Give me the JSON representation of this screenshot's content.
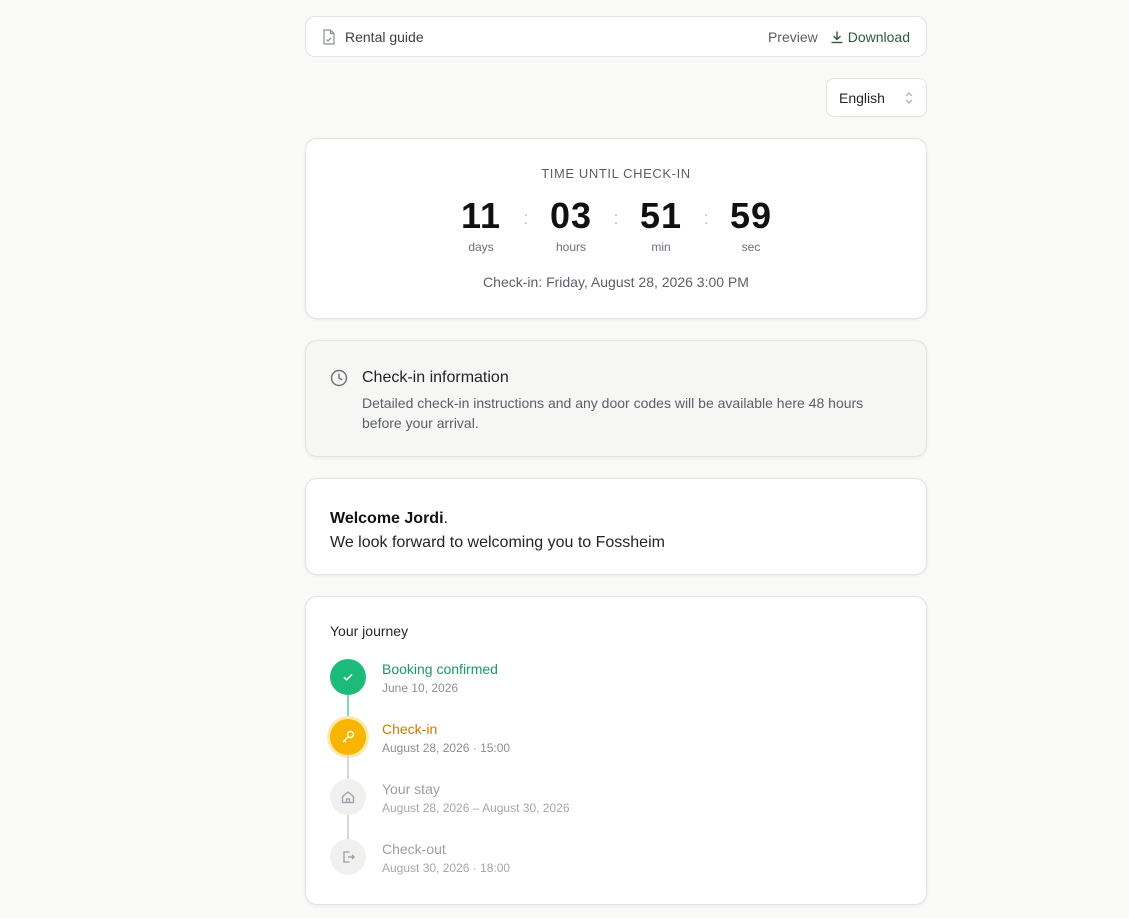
{
  "topbar": {
    "title": "Rental guide",
    "preview_label": "Preview",
    "download_label": "Download",
    "icons": {
      "doc": "document-icon",
      "download": "download-icon"
    }
  },
  "language": {
    "selected": "English"
  },
  "countdown": {
    "label": "TIME UNTIL CHECK-IN",
    "days": "11",
    "days_unit": "days",
    "hours": "03",
    "hours_unit": "hours",
    "minutes": "51",
    "minutes_unit": "min",
    "seconds": "59",
    "seconds_unit": "sec",
    "separator": ":",
    "checkin_text": "Check-in: Friday, August 28, 2026 3:00 PM"
  },
  "info": {
    "heading": "Check-in information",
    "description": "Detailed check-in instructions and any door codes will be available here 48 hours before your arrival."
  },
  "welcome": {
    "greeting": "Welcome Jordi",
    "greeting_suffix": ".",
    "message": "We look forward to welcoming you to Fossheim"
  },
  "journey": {
    "title": "Your journey",
    "steps": [
      {
        "name": "Booking confirmed",
        "date": "June 10, 2026",
        "status": "done",
        "icon": "check-icon"
      },
      {
        "name": "Check-in",
        "date": "August 28, 2026 · 15:00",
        "status": "active",
        "icon": "key-icon"
      },
      {
        "name": "Your stay",
        "date": "August 28, 2026 – August 30, 2026",
        "status": "pending",
        "icon": "home-icon"
      },
      {
        "name": "Check-out",
        "date": "August 30, 2026 · 18:00",
        "status": "pending",
        "icon": "exit-icon"
      }
    ]
  },
  "colors": {
    "done": "#1dbb79",
    "active": "#f7b500",
    "download": "#2d5a3d"
  }
}
